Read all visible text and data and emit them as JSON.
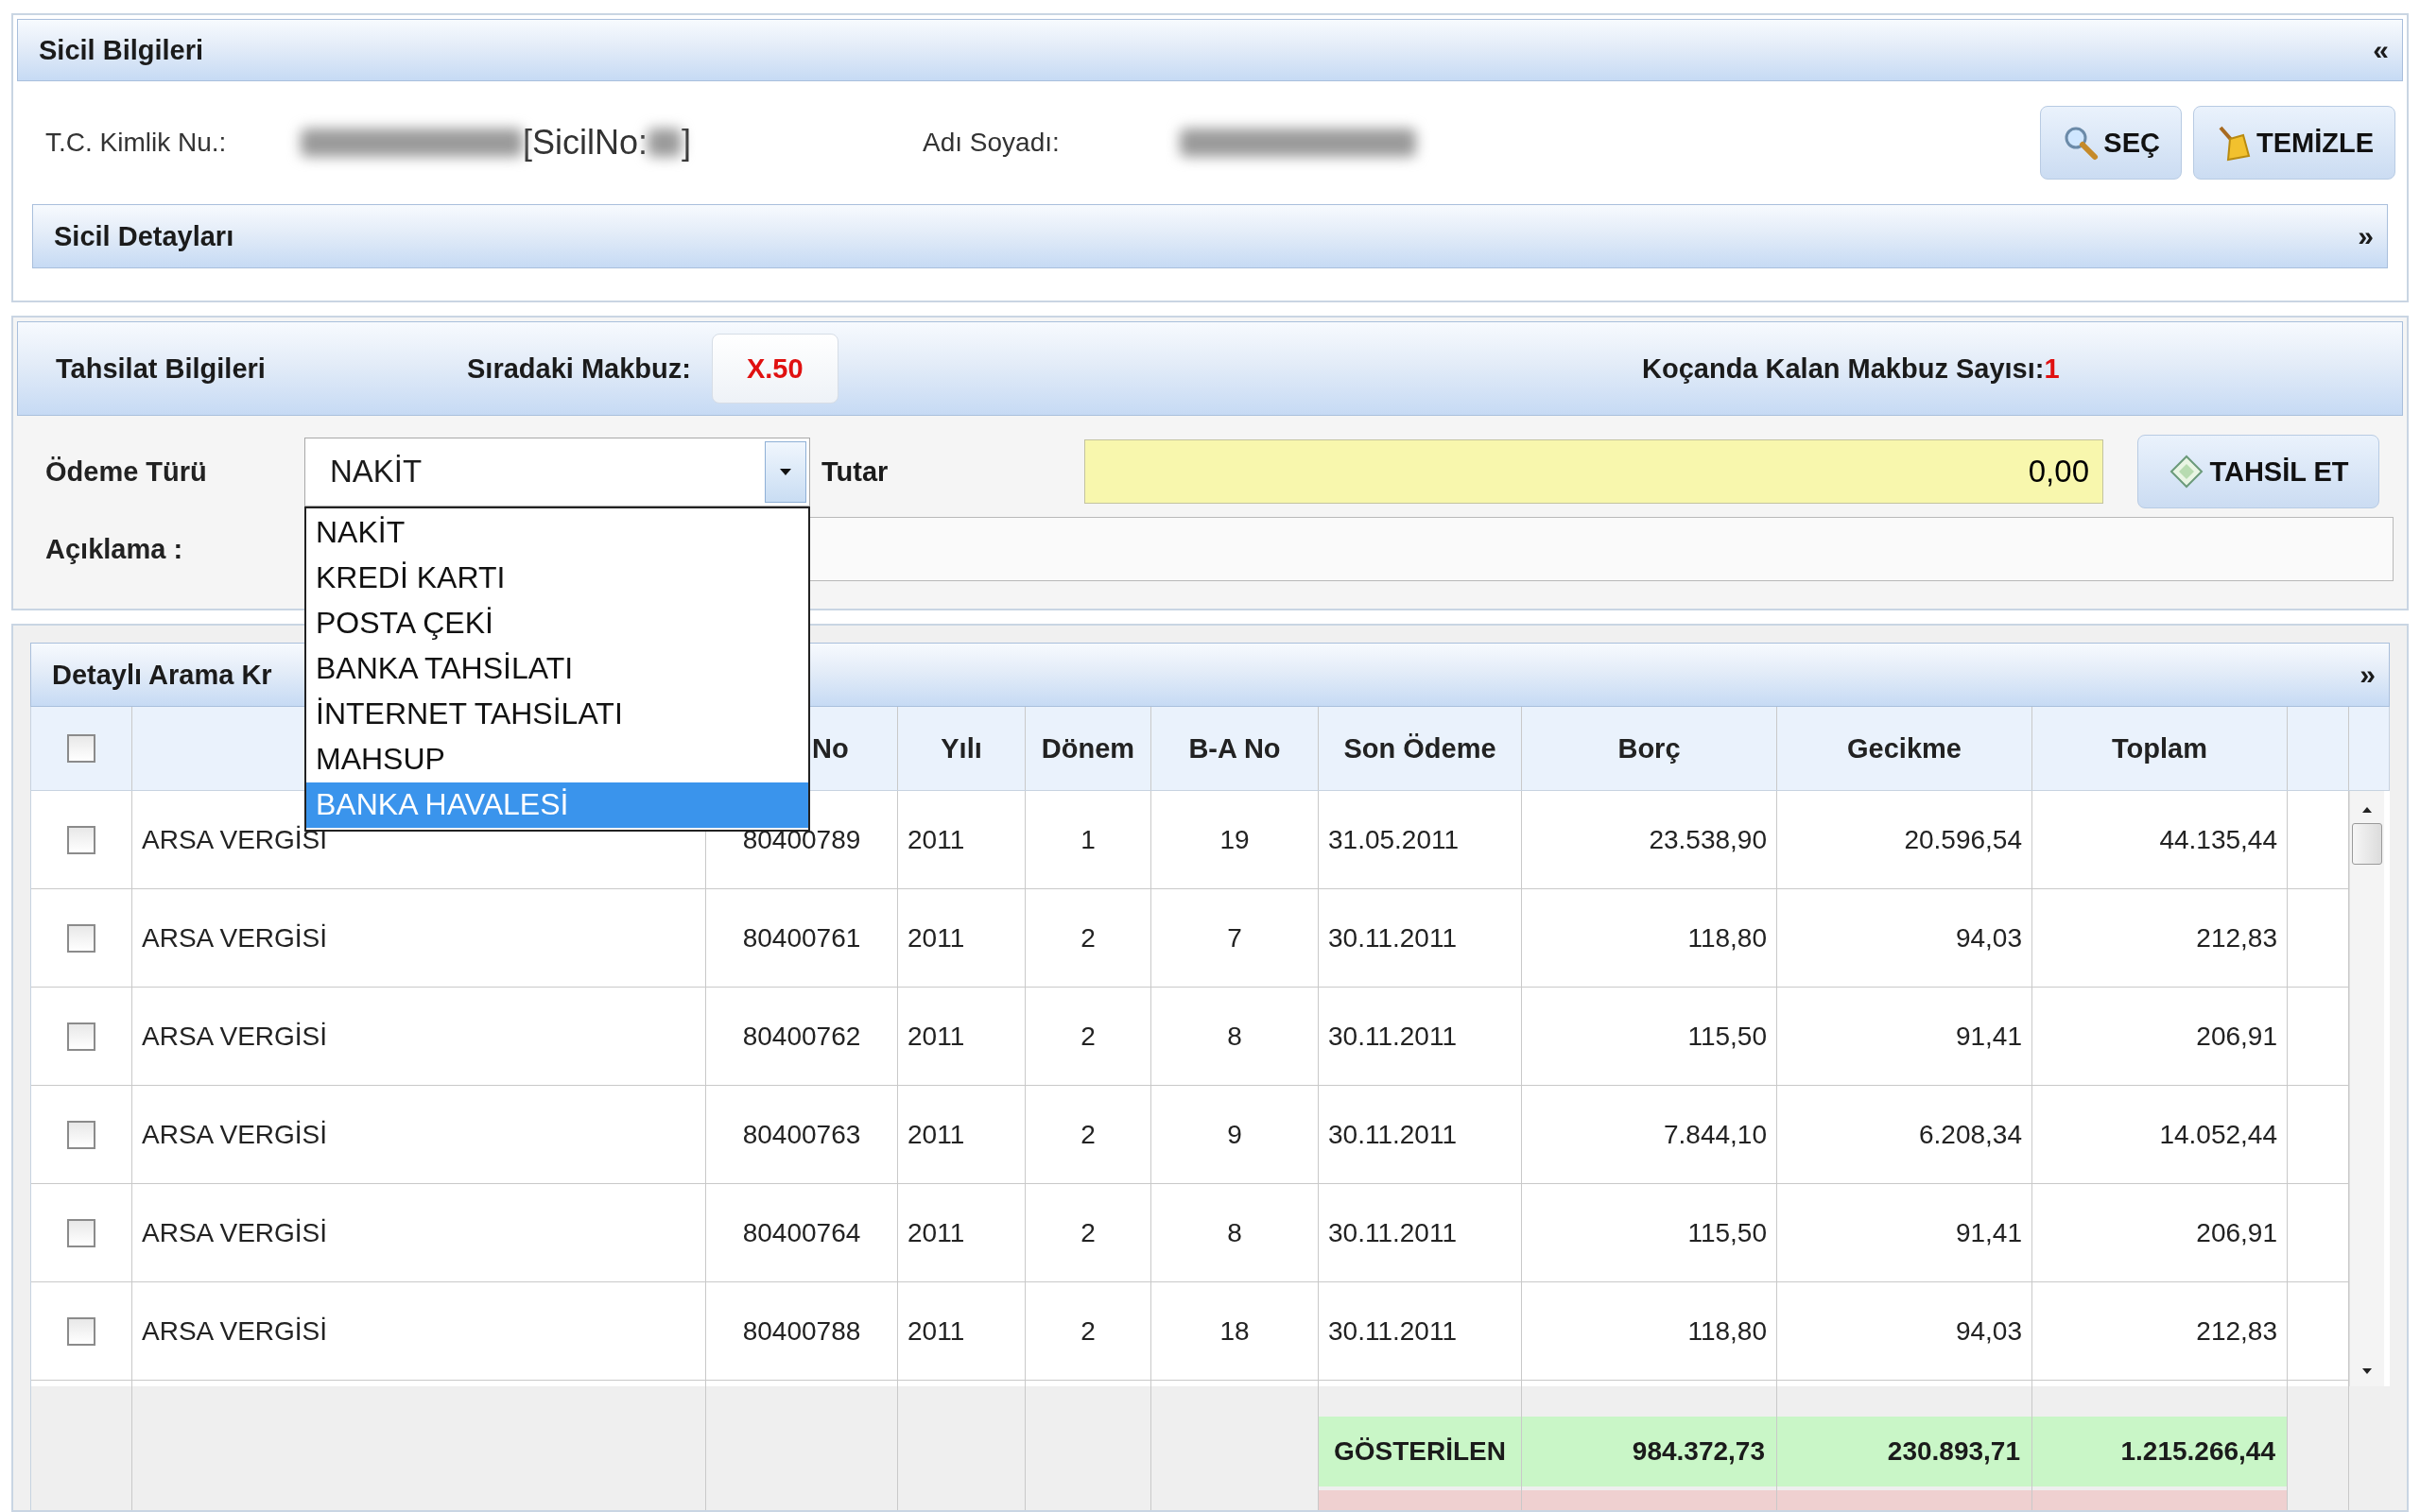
{
  "sicil": {
    "title": "Sicil Bilgileri",
    "collapse": "«",
    "tc_label": "T.C. Kimlik Nu.:",
    "tc_value": "[SicilNo:",
    "tc_value_end": "]",
    "name_label": "Adı Soyadı:",
    "buttons": [
      {
        "kind": "search",
        "label": "SEÇ"
      },
      {
        "kind": "clear",
        "label": "TEMİZLE"
      }
    ],
    "details": {
      "title": "Sicil Detayları",
      "expand": "»"
    }
  },
  "tahsilat": {
    "title": "Tahsilat Bilgileri",
    "next_receipt_label": "Sıradaki Makbuz:",
    "next_receipt": "X.50",
    "remaining_label": "Koçanda Kalan Makbuz Sayısı:",
    "remaining": "1",
    "payment_label": "Ödeme Türü",
    "payment_value": "NAKİT",
    "dropdown_open": true,
    "payment_options": [
      {
        "label": "NAKİT",
        "selected": false
      },
      {
        "label": "KREDİ KARTI",
        "selected": false
      },
      {
        "label": "POSTA ÇEKİ",
        "selected": false
      },
      {
        "label": "BANKA TAHSİLATI",
        "selected": false
      },
      {
        "label": "İNTERNET TAHSİLATI",
        "selected": false
      },
      {
        "label": "MAHSUP",
        "selected": false
      },
      {
        "label": "BANKA HAVALESİ",
        "selected": true
      }
    ],
    "amount_label": "Tutar",
    "amount": "0,00",
    "collect_button": "TAHSİL ET",
    "note_label": "Açıklama :"
  },
  "search": {
    "title": "Detaylı Arama Kr",
    "expand": "»",
    "table": {
      "all_checked": false,
      "columns": [
        "",
        "No",
        "Yılı",
        "Dönem",
        "B-A No",
        "Son Ödeme",
        "Borç",
        "Gecikme",
        "Toplam"
      ],
      "rows": [
        {
          "checked": false,
          "cells": [
            "ARSA VERGİSİ",
            "80400789",
            "2011",
            "1",
            "19",
            "31.05.2011",
            "23.538,90",
            "20.596,54",
            "44.135,44"
          ]
        },
        {
          "checked": false,
          "cells": [
            "ARSA VERGİSİ",
            "80400761",
            "2011",
            "2",
            "7",
            "30.11.2011",
            "118,80",
            "94,03",
            "212,83"
          ]
        },
        {
          "checked": false,
          "cells": [
            "ARSA VERGİSİ",
            "80400762",
            "2011",
            "2",
            "8",
            "30.11.2011",
            "115,50",
            "91,41",
            "206,91"
          ]
        },
        {
          "checked": false,
          "cells": [
            "ARSA VERGİSİ",
            "80400763",
            "2011",
            "2",
            "9",
            "30.11.2011",
            "7.844,10",
            "6.208,34",
            "14.052,44"
          ]
        },
        {
          "checked": false,
          "cells": [
            "ARSA VERGİSİ",
            "80400764",
            "2011",
            "2",
            "8",
            "30.11.2011",
            "115,50",
            "91,41",
            "206,91"
          ]
        },
        {
          "checked": false,
          "cells": [
            "ARSA VERGİSİ",
            "80400788",
            "2011",
            "2",
            "18",
            "30.11.2011",
            "118,80",
            "94,03",
            "212,83"
          ]
        }
      ],
      "totals": {
        "label": "GÖSTERİLEN",
        "values": [
          "984.372,73",
          "230.893,71",
          "1.215.266,44"
        ]
      }
    }
  }
}
